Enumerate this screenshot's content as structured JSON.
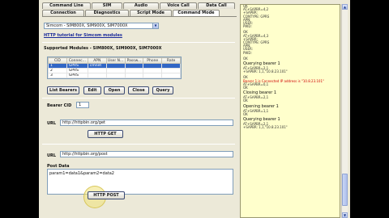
{
  "tabs_top": [
    {
      "label": "Command Line"
    },
    {
      "label": "SIM"
    },
    {
      "label": "Audio"
    },
    {
      "label": "Voice Call"
    },
    {
      "label": "Data Call"
    }
  ],
  "tabs_bottom": [
    {
      "label": "Connection"
    },
    {
      "label": "Diagnostics"
    },
    {
      "label": "Script Mode"
    },
    {
      "label": "Command Mode"
    }
  ],
  "module_select": {
    "value": "Simcom - SIM800X, SIM900X, SIM7000X"
  },
  "http_tutorial_link": "HTTP tutorial for Simcom modules",
  "supported_modules_label": "Supported Modules - SIM800X, SIM900X, SIM7000X",
  "bearer_table": {
    "columns": [
      "CID",
      "Connec...",
      "APN",
      "User N...",
      "Passw...",
      "Phone",
      "Rate"
    ],
    "rows": [
      [
        "1",
        "GPRS",
        "cmnet",
        "",
        "",
        "",
        ""
      ],
      [
        "2",
        "GPRS",
        "",
        "",
        "",
        "",
        ""
      ],
      [
        "3",
        "GPRS",
        "",
        "",
        "",
        "",
        ""
      ]
    ]
  },
  "buttons": {
    "list_bearers": "List Bearers",
    "edit": "Edit",
    "open": "Open",
    "close": "Close",
    "query": "Query",
    "http_get": "HTTP GET",
    "http_post": "HTTP POST"
  },
  "bearer_cid": {
    "label": "Bearer CID",
    "value": "1"
  },
  "get_url": {
    "label": "URL",
    "value": "http://httpbin.org/get"
  },
  "post_url": {
    "label": "URL",
    "value": "http://httpbin.org/post"
  },
  "post_data": {
    "label": "Post Data",
    "value": "param1=data1&param2=data2"
  },
  "log": [
    {
      "text": "OK",
      "style": "small"
    },
    {
      "text": "AT+SAPBR=4,2",
      "style": "small"
    },
    {
      "text": "+SAPBR:",
      "style": "small"
    },
    {
      "text": "CONTYPE: GPRS",
      "style": "small"
    },
    {
      "text": "APN:",
      "style": "small"
    },
    {
      "text": "USER:",
      "style": "small"
    },
    {
      "text": "PWD:",
      "style": "small"
    },
    {
      "text": "",
      "style": "gap"
    },
    {
      "text": "OK",
      "style": "small"
    },
    {
      "text": "AT+SAPBR=4,3",
      "style": "small"
    },
    {
      "text": "+SAPBR:",
      "style": "small"
    },
    {
      "text": "CONTYPE: GPRS",
      "style": "small"
    },
    {
      "text": "APN:",
      "style": "small"
    },
    {
      "text": "USER:",
      "style": "small"
    },
    {
      "text": "PWD:",
      "style": "small"
    },
    {
      "text": "",
      "style": "gap"
    },
    {
      "text": "OK",
      "style": "small"
    },
    {
      "text": "Querying bearer 1",
      "style": "big"
    },
    {
      "text": "AT+SAPBR=2,1",
      "style": "small"
    },
    {
      "text": "+SAPBR: 1,1,\"10.8.23.101\"",
      "style": "small"
    },
    {
      "text": "",
      "style": "gap"
    },
    {
      "text": "OK",
      "style": "small"
    },
    {
      "text": "Bearer 1 is Connected IP address is \"10.8.23.101\"",
      "style": "red"
    },
    {
      "text": "AT+SAPBR=0,1",
      "style": "small"
    },
    {
      "text": "OK",
      "style": "small"
    },
    {
      "text": "Closing bearer 1",
      "style": "big"
    },
    {
      "text": "AT+SAPBR=2,1",
      "style": "small"
    },
    {
      "text": "OK",
      "style": "small"
    },
    {
      "text": "Opening bearer 1",
      "style": "big"
    },
    {
      "text": "AT+SAPBR=1,1",
      "style": "small"
    },
    {
      "text": "OK",
      "style": "small"
    },
    {
      "text": "Querying bearer 1",
      "style": "big"
    },
    {
      "text": "AT+SAPBR=2,1",
      "style": "small"
    },
    {
      "text": "+SAPBR: 1,1,\"10.8.23.101\"",
      "style": "small"
    }
  ],
  "colors": {
    "log_bg": "#ffffcc",
    "selection": "#3166c5",
    "error_text": "#d00000",
    "link": "#1a2a9a"
  }
}
